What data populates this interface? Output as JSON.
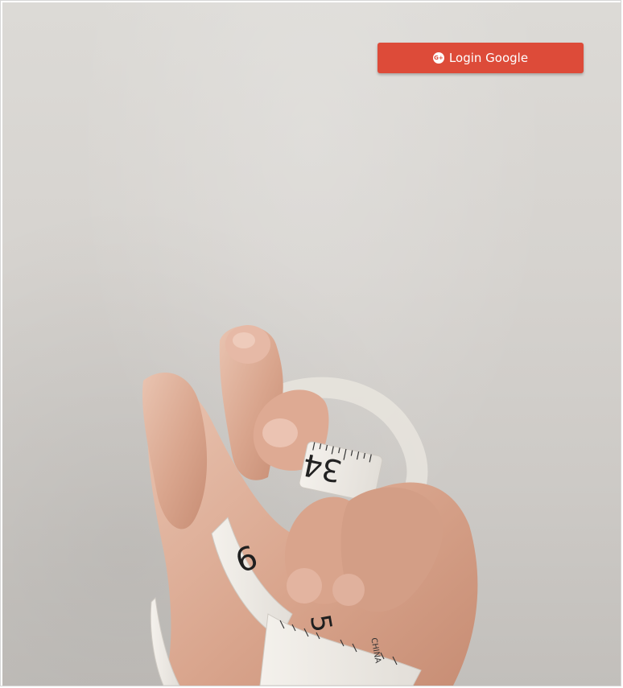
{
  "header": {
    "login_button_label": "Login Google",
    "login_icon": "google-plus-icon",
    "login_icon_glyph": "G+"
  },
  "hero": {
    "image_subject": "hand-holding-measuring-tape",
    "tape_numbers": [
      "34",
      "6",
      "5",
      "CHINA"
    ]
  },
  "colors": {
    "button_background": "#dd4b39",
    "background": "#d6d3cf"
  }
}
